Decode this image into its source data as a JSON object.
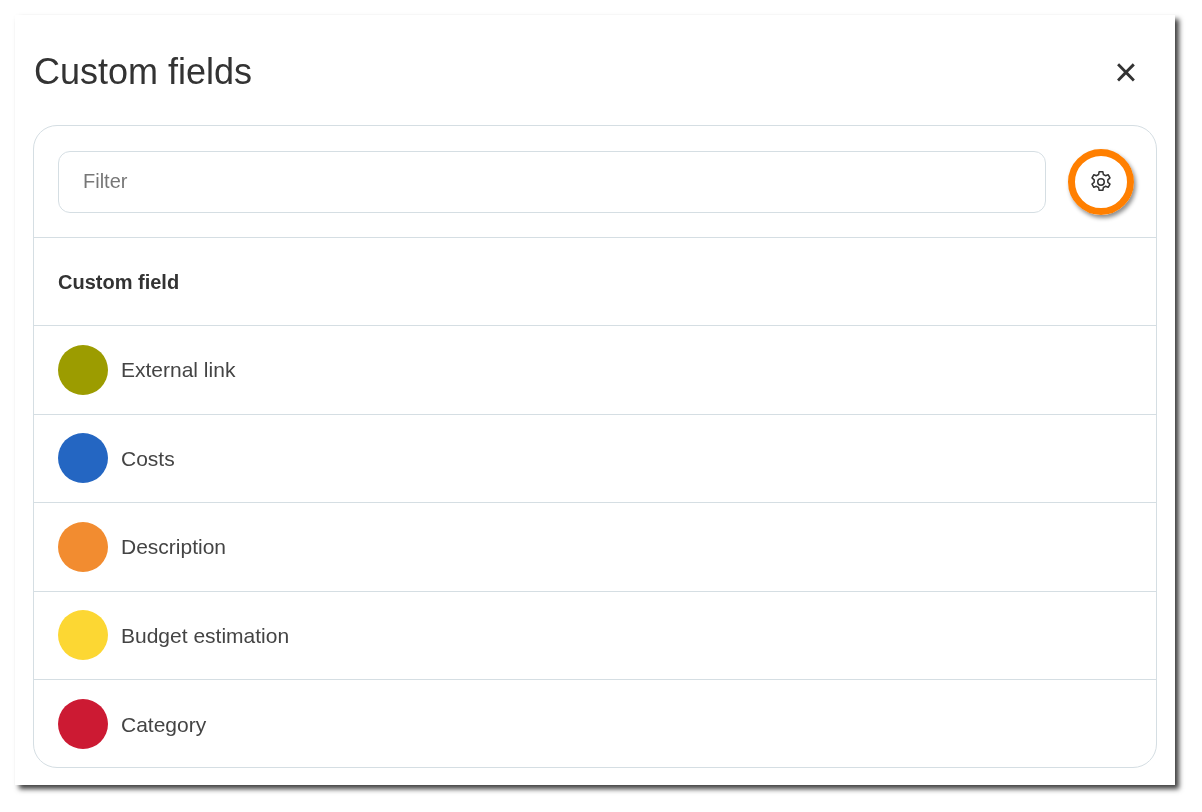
{
  "dialog": {
    "title": "Custom fields",
    "close_icon": "×"
  },
  "filter": {
    "placeholder": "Filter"
  },
  "settings_button": {
    "highlighted": true
  },
  "table": {
    "columns": [
      "Custom field"
    ],
    "rows": [
      {
        "label": "External link",
        "color": "#9c9c00"
      },
      {
        "label": "Costs",
        "color": "#2466c2"
      },
      {
        "label": "Description",
        "color": "#f28c30"
      },
      {
        "label": "Budget estimation",
        "color": "#fcd733"
      },
      {
        "label": "Category",
        "color": "#cc1a33"
      }
    ]
  }
}
